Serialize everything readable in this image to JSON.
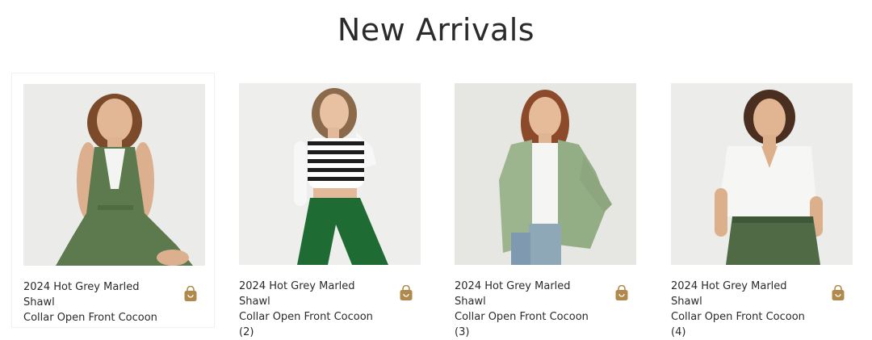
{
  "section": {
    "title": "New Arrivals"
  },
  "products": [
    {
      "name_line1": "2024 Hot Grey Marled Shawl",
      "name_line2": "Collar Open Front Cocoon",
      "photo_icon": "model-green-sleeveless-jumpsuit"
    },
    {
      "name_line1": "2024 Hot Grey Marled Shawl",
      "name_line2": "Collar Open Front Cocoon (2)",
      "photo_icon": "model-striped-crop-top-green-pants"
    },
    {
      "name_line1": "2024 Hot Grey Marled Shawl",
      "name_line2": "Collar Open Front Cocoon (3)",
      "photo_icon": "model-sage-jacket-denim"
    },
    {
      "name_line1": "2024 Hot Grey Marled Shawl",
      "name_line2": "Collar Open Front Cocoon (4)",
      "photo_icon": "model-white-blouse-green-pants"
    }
  ],
  "colors": {
    "bag_icon": "#b08a4c",
    "title_text": "#2b2b2b",
    "photo_bg": "#ececea"
  },
  "icons": {
    "cart": "shopping-bag-icon"
  }
}
